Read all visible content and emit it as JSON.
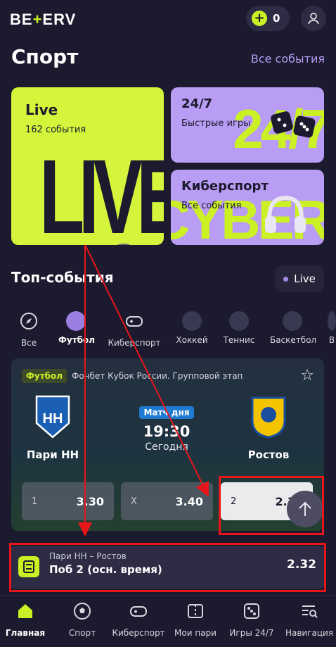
{
  "header": {
    "logo_pre": "BE",
    "logo_plus": "+",
    "logo_post": "ERV",
    "balance": "0"
  },
  "page": {
    "title": "Спорт",
    "all_events": "Все события"
  },
  "tiles": {
    "live": {
      "title": "Live",
      "sub": "162 события",
      "deco": "LIVE"
    },
    "fast": {
      "title": "24/7",
      "sub": "Быстрые игры",
      "deco": "24/7"
    },
    "cyber": {
      "title": "Киберспорт",
      "sub": "Все события",
      "deco": "CYBER"
    }
  },
  "top": {
    "title": "Топ-события",
    "live_label": "Live"
  },
  "sports": [
    {
      "label": "Все",
      "icon": "compass-icon"
    },
    {
      "label": "Футбол",
      "icon": "soccer-ball-icon"
    },
    {
      "label": "Киберспорт",
      "icon": "gamepad-icon"
    },
    {
      "label": "Хоккей",
      "icon": "hockey-puck-icon"
    },
    {
      "label": "Теннис",
      "icon": "tennis-ball-icon"
    },
    {
      "label": "Баскетбол",
      "icon": "basketball-icon"
    },
    {
      "label": "В"
    }
  ],
  "event": {
    "sport_badge": "Футбол",
    "league": "Фонбет Кубок России. Групповой этап",
    "home": "Пари НН",
    "away": "Ростов",
    "motd": "Матч дня",
    "time": "19:30",
    "day": "Сегодня",
    "odds": [
      {
        "key": "1",
        "value": "3.30"
      },
      {
        "key": "X",
        "value": "3.40"
      },
      {
        "key": "2",
        "value": "2.32"
      }
    ]
  },
  "slip": {
    "match": "Пари НН – Ростов",
    "bet": "Поб 2 (осн. время)",
    "coef": "2.32"
  },
  "nav": [
    {
      "label": "Главная",
      "icon": "home-icon"
    },
    {
      "label": "Спорт",
      "icon": "soccer-ball-icon"
    },
    {
      "label": "Киберспорт",
      "icon": "gamepad-icon"
    },
    {
      "label": "Мои пари",
      "icon": "ticket-icon"
    },
    {
      "label": "Игры 24/7",
      "icon": "dice-icon"
    },
    {
      "label": "Навигация",
      "icon": "menu-search-icon"
    }
  ],
  "colors": {
    "accent": "#cbf024",
    "purple": "#b99cf3",
    "background": "#1b1a2e",
    "annotation": "#e8161a"
  }
}
